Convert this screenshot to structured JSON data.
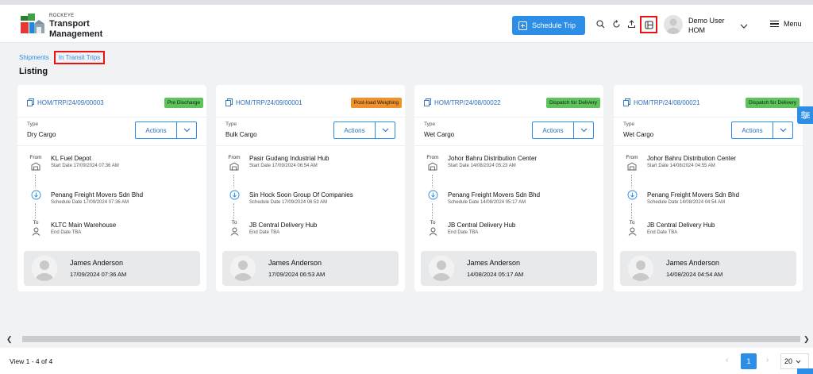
{
  "header": {
    "logo_small": "ROCKEYE",
    "logo_line1": "Transport",
    "logo_line2": "Management",
    "schedule_button": "Schedule Trip",
    "user_name": "Demo User",
    "user_role": "HOM",
    "menu_label": "Menu"
  },
  "breadcrumb": {
    "shipments": "Shipments",
    "in_transit": "In Transit Trips"
  },
  "page_title": "Listing",
  "type_label": "Type",
  "actions_label": "Actions",
  "from_label": "From",
  "to_label": "To",
  "cards": [
    {
      "trip_id": "HOM/TRP/24/09/00003",
      "status": "Pre Discharge",
      "status_color": "#5cc45a",
      "type": "Dry Cargo",
      "from_name": "KL Fuel Depot",
      "from_date": "Start Date 17/09/2024 07:36 AM",
      "mid_name": "Penang Freight Movers Sdn Bhd",
      "mid_date": "Schedule Date 17/09/2024 07:36 AM",
      "to_name": "KLTC Main Warehouse",
      "to_date": "End Date TBA",
      "driver_name": "James Anderson",
      "driver_date": "17/09/2024 07:36 AM"
    },
    {
      "trip_id": "HOM/TRP/24/09/00001",
      "status": "Post-load Weighing",
      "status_color": "#f0922b",
      "type": "Bulk Cargo",
      "from_name": "Pasir Gudang Industrial Hub",
      "from_date": "Start Date 17/09/2024 06:54 AM",
      "mid_name": "Sin Hock Soon Group Of Companies",
      "mid_date": "Schedule Date 17/09/2024 06:53 AM",
      "to_name": "JB Central Delivery Hub",
      "to_date": "End Date TBA",
      "driver_name": "James Anderson",
      "driver_date": "17/09/2024 06:53 AM"
    },
    {
      "trip_id": "HOM/TRP/24/08/00022",
      "status": "Dispatch for Delivery",
      "status_color": "#5cc45a",
      "type": "Wet Cargo",
      "from_name": "Johor Bahru Distribution Center",
      "from_date": "Start Date 14/08/2024 05:23 AM",
      "mid_name": "Penang Freight Movers Sdn Bhd",
      "mid_date": "Schedule Date 14/08/2024 05:17 AM",
      "to_name": "JB Central Delivery Hub",
      "to_date": "End Date TBA",
      "driver_name": "James Anderson",
      "driver_date": "14/08/2024 05:17 AM"
    },
    {
      "trip_id": "HOM/TRP/24/08/00021",
      "status": "Dispatch for Delivery",
      "status_color": "#5cc45a",
      "type": "Wet Cargo",
      "from_name": "Johor Bahru Distribution Center",
      "from_date": "Start Date 14/08/2024 04:55 AM",
      "mid_name": "Penang Freight Movers Sdn Bhd",
      "mid_date": "Schedule Date 14/08/2024 04:54 AM",
      "to_name": "JB Central Delivery Hub",
      "to_date": "End Date TBA",
      "driver_name": "James Anderson",
      "driver_date": "14/08/2024 04:54 AM"
    }
  ],
  "footer": {
    "view_count": "View 1 - 4 of 4",
    "current_page": "1",
    "page_size": "20"
  }
}
